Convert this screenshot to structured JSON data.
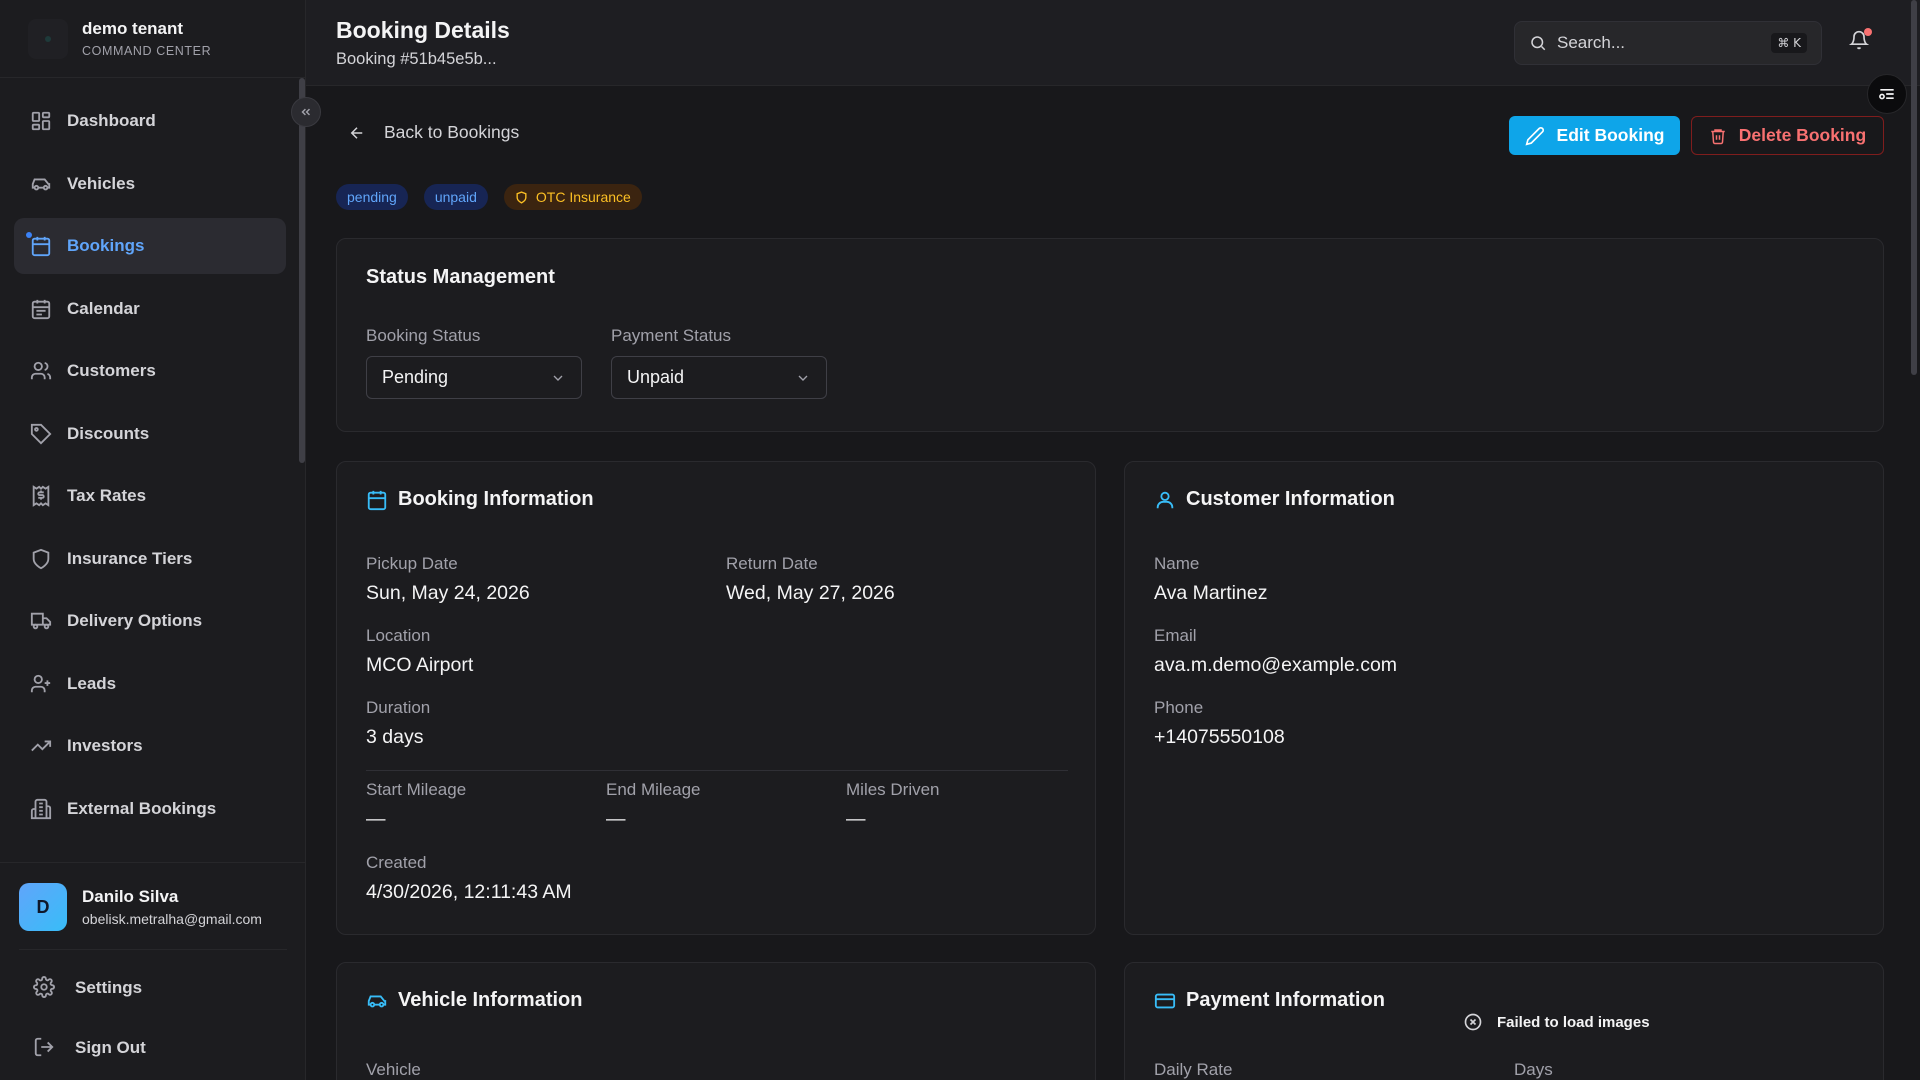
{
  "brand": {
    "name": "demo tenant",
    "subtitle": "COMMAND CENTER"
  },
  "sidebar": {
    "items": [
      {
        "label": "Dashboard",
        "icon": "dashboard-icon"
      },
      {
        "label": "Vehicles",
        "icon": "car-icon"
      },
      {
        "label": "Bookings",
        "icon": "calendar-grid-icon",
        "active": true
      },
      {
        "label": "Calendar",
        "icon": "calendar-icon"
      },
      {
        "label": "Customers",
        "icon": "users-icon"
      },
      {
        "label": "Discounts",
        "icon": "tag-icon"
      },
      {
        "label": "Tax Rates",
        "icon": "receipt-icon"
      },
      {
        "label": "Insurance Tiers",
        "icon": "shield-icon"
      },
      {
        "label": "Delivery Options",
        "icon": "truck-icon"
      },
      {
        "label": "Leads",
        "icon": "user-plus-icon"
      },
      {
        "label": "Investors",
        "icon": "trending-up-icon"
      },
      {
        "label": "External Bookings",
        "icon": "building-icon"
      }
    ]
  },
  "user": {
    "initial": "D",
    "name": "Danilo Silva",
    "email": "obelisk.metralha@gmail.com"
  },
  "footer_nav": {
    "settings": "Settings",
    "signout": "Sign Out"
  },
  "header": {
    "title": "Booking Details",
    "subtitle": "Booking #51b45e5b...",
    "search_placeholder": "Search...",
    "search_shortcut": "⌘ K"
  },
  "actions": {
    "back": "Back to Bookings",
    "edit": "Edit Booking",
    "delete": "Delete Booking"
  },
  "badges": {
    "status": "pending",
    "payment": "unpaid",
    "insurance": "OTC Insurance"
  },
  "status_management": {
    "title": "Status Management",
    "booking_status_label": "Booking Status",
    "booking_status_value": "Pending",
    "payment_status_label": "Payment Status",
    "payment_status_value": "Unpaid"
  },
  "booking_info": {
    "title": "Booking Information",
    "pickup_label": "Pickup Date",
    "pickup_value": "Sun, May 24, 2026",
    "return_label": "Return Date",
    "return_value": "Wed, May 27, 2026",
    "location_label": "Location",
    "location_value": "MCO Airport",
    "duration_label": "Duration",
    "duration_value": "3 days",
    "start_mileage_label": "Start Mileage",
    "start_mileage_value": "—",
    "end_mileage_label": "End Mileage",
    "end_mileage_value": "—",
    "miles_driven_label": "Miles Driven",
    "miles_driven_value": "—",
    "created_label": "Created",
    "created_value": "4/30/2026, 12:11:43 AM"
  },
  "customer_info": {
    "title": "Customer Information",
    "name_label": "Name",
    "name_value": "Ava Martinez",
    "email_label": "Email",
    "email_value": "ava.m.demo@example.com",
    "phone_label": "Phone",
    "phone_value": "+14075550108"
  },
  "vehicle_info": {
    "title": "Vehicle Information",
    "vehicle_label": "Vehicle"
  },
  "payment_info": {
    "title": "Payment Information",
    "daily_rate_label": "Daily Rate",
    "days_label": "Days"
  },
  "toast": {
    "message": "Failed to load images"
  },
  "colors": {
    "accent": "#0ea5e9",
    "danger": "#f87171",
    "background": "#18181b",
    "card": "#1c1c1f"
  }
}
